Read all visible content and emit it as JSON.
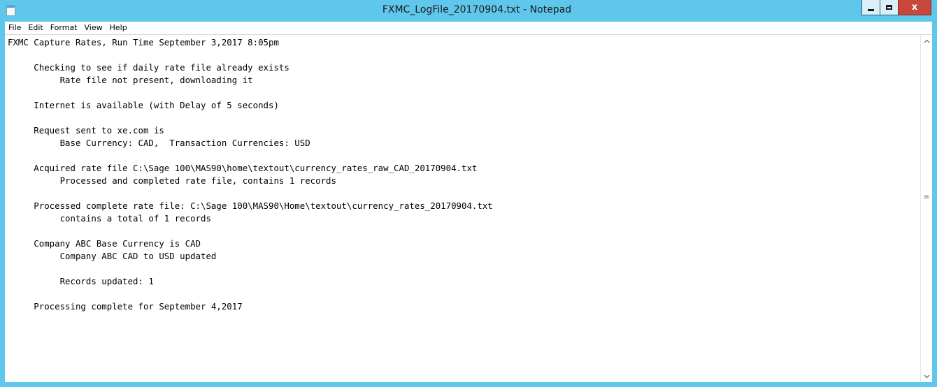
{
  "window": {
    "title": "FXMC_LogFile_20170904.txt - Notepad",
    "icon": "notepad-icon",
    "controls": {
      "minimize": "minimize-icon",
      "maximize": "maximize-icon",
      "close_label": "x"
    }
  },
  "menu": {
    "items": [
      {
        "label": "File"
      },
      {
        "label": "Edit"
      },
      {
        "label": "Format"
      },
      {
        "label": "View"
      },
      {
        "label": "Help"
      }
    ]
  },
  "document": {
    "lines": [
      "FXMC Capture Rates, Run Time September 3,2017 8:05pm",
      "",
      "     Checking to see if daily rate file already exists",
      "          Rate file not present, downloading it",
      "",
      "     Internet is available (with Delay of 5 seconds)",
      "",
      "     Request sent to xe.com is",
      "          Base Currency: CAD,  Transaction Currencies: USD",
      "",
      "     Acquired rate file C:\\Sage 100\\MAS90\\home\\textout\\currency_rates_raw_CAD_20170904.txt",
      "          Processed and completed rate file, contains 1 records",
      "",
      "     Processed complete rate file: C:\\Sage 100\\MAS90\\Home\\textout\\currency_rates_20170904.txt",
      "          contains a total of 1 records",
      "",
      "     Company ABC Base Currency is CAD",
      "          Company ABC CAD to USD updated",
      "",
      "          Records updated: 1",
      "",
      "     Processing complete for September 4,2017"
    ]
  },
  "scrollbar": {
    "up_arrow": "^",
    "down_arrow": "v",
    "grip": "≡"
  },
  "colors": {
    "titlebar": "#5fc6ec",
    "close_button": "#c7473a"
  }
}
